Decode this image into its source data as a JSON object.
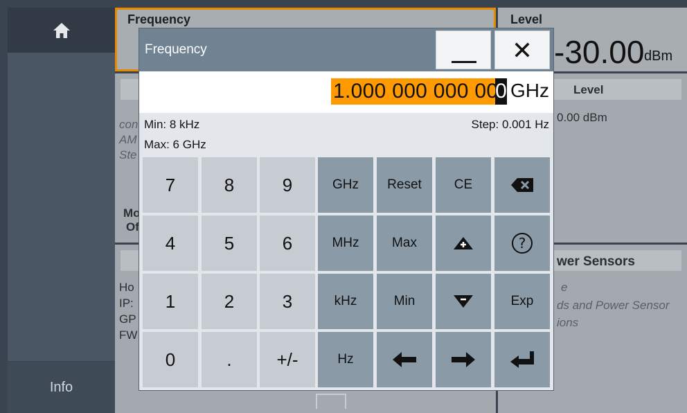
{
  "sidebar": {
    "home_icon": "home-icon",
    "info_label": "Info"
  },
  "background": {
    "frequency_tile_label": "Frequency",
    "level_tile_label": "Level",
    "level_value": "-30.00",
    "level_unit": "dBm",
    "level_header_2": "Level",
    "level_value_2": "0.00 dBm",
    "modulation_label_line1": "Mo",
    "modulation_label_line2": "Of",
    "misc_italic_1": "con",
    "misc_italic_2": "AM",
    "misc_italic_3": "Ste",
    "info_line_1": "Ho",
    "info_line_2": "IP:",
    "info_line_3": "GP",
    "info_line_4": "FW",
    "power_sensors_header": "wer Sensors",
    "power_sensors_line1": "e",
    "power_sensors_line2": "ds and Power Sensor",
    "power_sensors_line3": "ions"
  },
  "dialog": {
    "title": "Frequency",
    "minimize_icon": "minimize-icon",
    "close_icon": "close-icon",
    "value_main": "1.000 000 000 00",
    "value_cursor_digit": "0",
    "value_unit": "GHz",
    "min_text": "Min: 8 kHz",
    "max_text": "Max: 6 GHz",
    "step_text": "Step: 0.001 Hz"
  },
  "keypad": {
    "digits": [
      "7",
      "8",
      "9",
      "4",
      "5",
      "6",
      "1",
      "2",
      "3",
      "0",
      ".",
      "+/-"
    ],
    "units": [
      "GHz",
      "MHz",
      "kHz",
      "Hz"
    ],
    "reset": "Reset",
    "max": "Max",
    "min": "Min",
    "ce": "CE",
    "exp": "Exp",
    "backspace_icon": "backspace-icon",
    "help_icon": "help-icon",
    "increment_icon": "arrow-up-icon",
    "decrement_icon": "arrow-down-icon",
    "left_icon": "arrow-left-icon",
    "right_icon": "arrow-right-icon",
    "enter_icon": "enter-icon"
  },
  "colors": {
    "accent_orange": "#ff9a00",
    "title_bar": "#708393",
    "key_light": "#c6ccd2",
    "key_dark": "#8a9aa7"
  }
}
